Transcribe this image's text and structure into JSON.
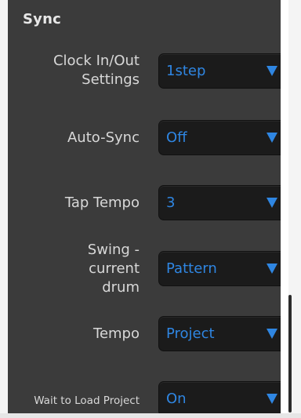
{
  "section": {
    "title": "Sync"
  },
  "rows": [
    {
      "label_lines": [
        "Clock In/Out",
        "Settings"
      ],
      "value": "1step"
    },
    {
      "label_lines": [
        "Auto-Sync"
      ],
      "value": "Off"
    },
    {
      "label_lines": [
        "Tap Tempo"
      ],
      "value": "3"
    },
    {
      "label_lines": [
        "Swing -",
        "current",
        "drum"
      ],
      "value": "Pattern"
    },
    {
      "label_lines": [
        "Tempo"
      ],
      "value": "Project"
    },
    {
      "label_lines": [
        "Wait to Load Project"
      ],
      "value": "On"
    }
  ],
  "colors": {
    "panel_bg": "#3b3b3b",
    "select_bg": "#1b1b1b",
    "accent": "#2f86e2",
    "label_text": "#d8d8d8"
  },
  "icons": {
    "dropdown": "triangle-down-icon"
  }
}
